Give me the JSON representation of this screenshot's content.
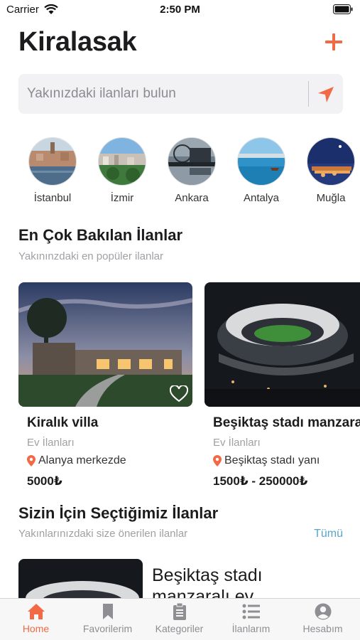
{
  "status_bar": {
    "carrier": "Carrier",
    "time": "2:50 PM"
  },
  "header": {
    "title": "Kiralasak"
  },
  "search": {
    "placeholder": "Yakınızdaki ilanları bulun",
    "value": ""
  },
  "cities": [
    {
      "label": "İstanbul"
    },
    {
      "label": "İzmir"
    },
    {
      "label": "Ankara"
    },
    {
      "label": "Antalya"
    },
    {
      "label": "Muğla"
    }
  ],
  "popular": {
    "title": "En Çok Bakılan İlanlar",
    "subtitle": "Yakınınzdaki en popüler ilanlar",
    "cards": [
      {
        "title": "Kiralık villa",
        "category": "Ev İlanları",
        "location": "Alanya merkezde",
        "price": "5000₺"
      },
      {
        "title": "Beşiktaş stadı manzaralı ev",
        "category": "Ev İlanları",
        "location": "Beşiktaş stadı yanı",
        "price": "1500₺ - 250000₺"
      }
    ]
  },
  "recommended": {
    "title": "Sizin İçin Seçtiğimiz İlanlar",
    "subtitle": "Yakınlarınızdaki size önerilen ilanlar",
    "see_all": "Tümü",
    "items": [
      {
        "title": "Beşiktaş stadı manzaralı ev"
      }
    ]
  },
  "tabs": [
    {
      "label": "Home",
      "icon": "home-icon",
      "active": true
    },
    {
      "label": "Favorilerim",
      "icon": "bookmark-icon",
      "active": false
    },
    {
      "label": "Kategoriler",
      "icon": "clipboard-icon",
      "active": false
    },
    {
      "label": "İlanlarım",
      "icon": "list-icon",
      "active": false
    },
    {
      "label": "Hesabım",
      "icon": "user-icon",
      "active": false
    }
  ],
  "colors": {
    "accent": "#f16a45",
    "link": "#5aa6c8",
    "inactive": "#8e8e93"
  }
}
